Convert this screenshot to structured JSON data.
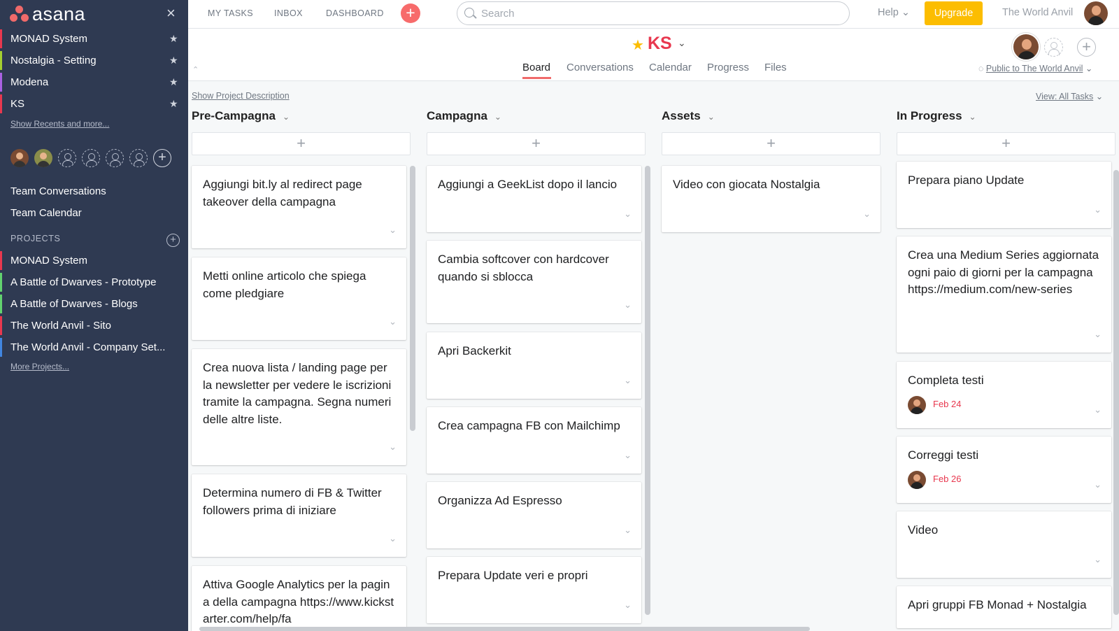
{
  "sidebar": {
    "logo_text": "asana",
    "close_glyph": "×",
    "favorites": [
      {
        "label": "MONAD System",
        "color": "#e8384f"
      },
      {
        "label": "Nostalgia - Setting",
        "color": "#a4cf30"
      },
      {
        "label": "Modena",
        "color": "#aa62e3"
      },
      {
        "label": "KS",
        "color": "#e8384f"
      }
    ],
    "show_recents": "Show Recents and more...",
    "team_links": [
      "Team Conversations",
      "Team Calendar"
    ],
    "projects_heading": "PROJECTS",
    "projects": [
      {
        "label": "MONAD System",
        "color": "#e8384f"
      },
      {
        "label": "A Battle of Dwarves - Prototype",
        "color": "#62d26f"
      },
      {
        "label": "A Battle of Dwarves - Blogs",
        "color": "#62d26f"
      },
      {
        "label": "The World Anvil - Sito",
        "color": "#e8384f"
      },
      {
        "label": "The World Anvil - Company Set...",
        "color": "#4186e0"
      }
    ],
    "more_projects": "More Projects..."
  },
  "topbar": {
    "nav": [
      "MY TASKS",
      "INBOX",
      "DASHBOARD"
    ],
    "search_placeholder": "Search",
    "help": "Help",
    "upgrade": "Upgrade",
    "org_name": "The World Anvil"
  },
  "project": {
    "title": "KS",
    "tabs": [
      "Board",
      "Conversations",
      "Calendar",
      "Progress",
      "Files"
    ],
    "active_tab": "Board",
    "privacy": "Public to The World Anvil",
    "show_description": "Show Project Description",
    "view_filter": "View: All Tasks"
  },
  "columns": [
    {
      "title": "Pre-Campagna",
      "cards": [
        {
          "text": "Aggiungi bit.ly al redirect page takeover della campagna"
        },
        {
          "text": "Metti online articolo che spiega come pledgiare"
        },
        {
          "text": "Crea nuova lista / landing page per la newsletter per vedere le iscrizioni tramite la campagna. Segna numeri delle altre liste."
        },
        {
          "text": "Determina numero di FB & Twitter followers prima di iniziare"
        },
        {
          "text": "Attiva Google Analytics per la pagina della campagna https://www.kickstarter.com/help/fa"
        }
      ]
    },
    {
      "title": "Campagna",
      "cards": [
        {
          "text": "Aggiungi a GeekList dopo il lancio"
        },
        {
          "text": "Cambia softcover con hardcover quando si sblocca"
        },
        {
          "text": "Apri Backerkit"
        },
        {
          "text": "Crea campagna FB con Mailchimp"
        },
        {
          "text": "Organizza Ad Espresso"
        },
        {
          "text": "Prepara Update veri e propri"
        }
      ]
    },
    {
      "title": "Assets",
      "cards": [
        {
          "text": "Video con giocata Nostalgia"
        }
      ]
    },
    {
      "title": "In Progress",
      "cards": [
        {
          "text": "Prepara piano Update"
        },
        {
          "text": "Crea una Medium Series aggiornata ogni paio di giorni per la campagna https://medium.com/new-series"
        },
        {
          "text": "Completa testi",
          "due": "Feb 24"
        },
        {
          "text": "Correggi testi",
          "due": "Feb 26"
        },
        {
          "text": "Video"
        },
        {
          "text": "Apri gruppi FB Monad + Nostalgia"
        }
      ]
    }
  ],
  "icons": {
    "favorite_star": "★",
    "add": "+",
    "chevron": "⌄",
    "collapse": "⌃"
  }
}
